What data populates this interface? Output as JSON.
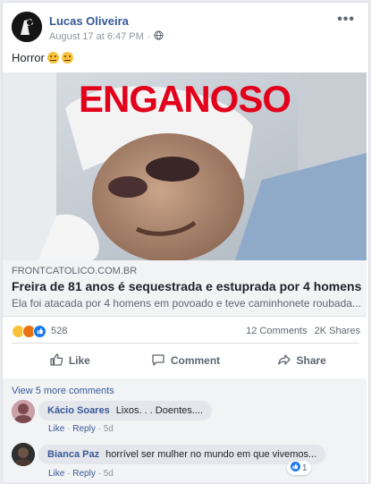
{
  "post": {
    "author": "Lucas Oliveira",
    "timestamp": "August 17 at 6:47 PM",
    "separator": "·",
    "more_options": "•••",
    "text": "Horror"
  },
  "image": {
    "stamp_text": "ENGANOSO"
  },
  "link_preview": {
    "domain": "FRONTCATOLICO.COM.BR",
    "title": "Freira de 81 anos é sequestrada e estuprada por 4 homens",
    "description": "Ela foi atacada por 4 homens em povoado e teve caminhonete roubada...."
  },
  "stats": {
    "reaction_count": "528",
    "comments": "12 Comments",
    "shares": "2K Shares"
  },
  "actions": {
    "like": "Like",
    "comment": "Comment",
    "share": "Share"
  },
  "comments_section": {
    "view_more": "View 5 more comments",
    "items": [
      {
        "name": "Kácio Soares",
        "text": "Lixos. . . Doentes....",
        "like": "Like",
        "reply": "Reply",
        "sep": "·",
        "time": "5d"
      },
      {
        "name": "Bianca Paz",
        "text": "horrível ser mulher no mundo em que vivemos...",
        "like": "Like",
        "reply": "Reply",
        "sep": "·",
        "time": "5d",
        "like_count": "1"
      }
    ]
  },
  "colors": {
    "link_blue": "#365899",
    "stamp_red": "#e3001b",
    "like_blue": "#1877f2"
  }
}
